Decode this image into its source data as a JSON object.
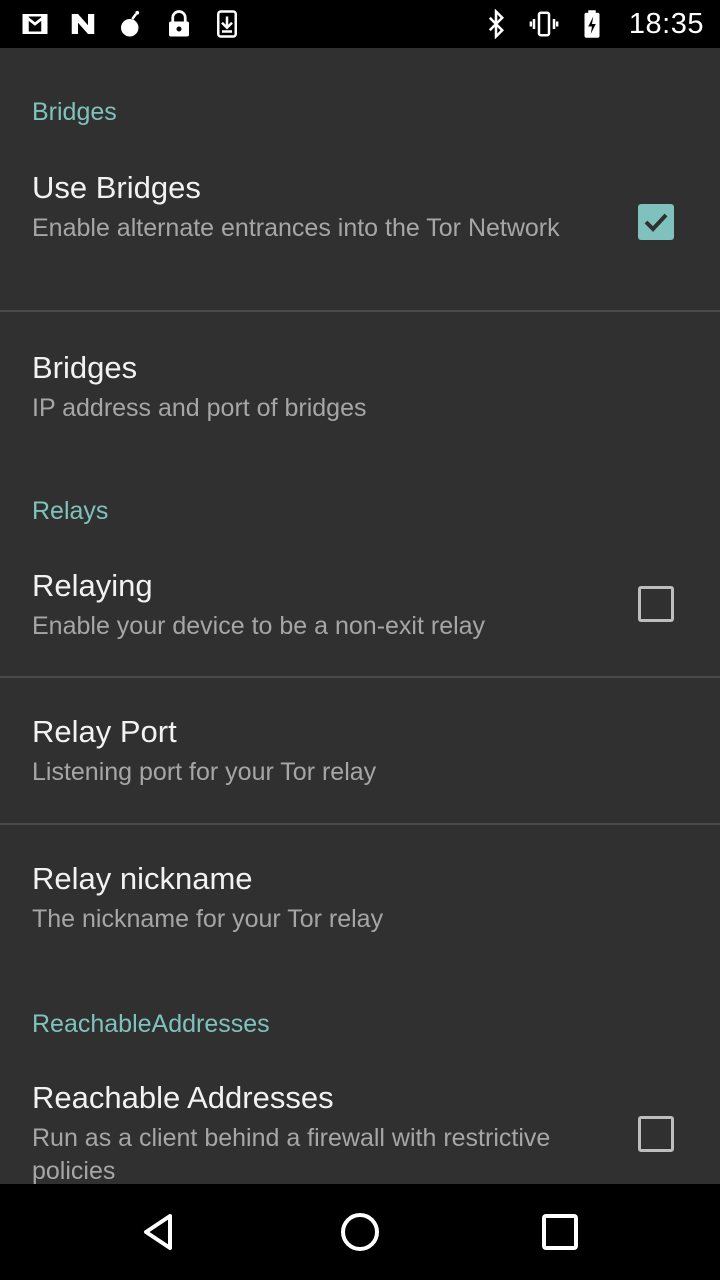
{
  "status_bar": {
    "left_icons": [
      "gmail-icon",
      "notification-n-icon",
      "bomb-icon",
      "lock-icon",
      "download-icon"
    ],
    "right_icons": [
      "bluetooth-icon",
      "vibrate-icon",
      "battery-charging-icon"
    ],
    "time": "18:35"
  },
  "sections": {
    "bridges": {
      "header": "Bridges",
      "use_bridges": {
        "title": "Use Bridges",
        "summary": "Enable alternate entrances into the Tor Network",
        "checked": true
      },
      "bridges": {
        "title": "Bridges",
        "summary": "IP address and port of bridges"
      }
    },
    "relays": {
      "header": "Relays",
      "relaying": {
        "title": "Relaying",
        "summary": "Enable your device to be a non-exit relay",
        "checked": false
      },
      "relay_port": {
        "title": "Relay Port",
        "summary": "Listening port for your Tor relay"
      },
      "relay_nickname": {
        "title": "Relay nickname",
        "summary": "The nickname for your Tor relay"
      }
    },
    "reachable": {
      "header": "ReachableAddresses",
      "reachable_addresses": {
        "title": "Reachable Addresses",
        "summary": "Run as a client behind a firewall with restrictive policies",
        "checked": false
      }
    }
  },
  "nav_bar": {
    "buttons": [
      "back-icon",
      "home-icon",
      "recents-icon"
    ]
  },
  "colors": {
    "accent": "#7fc2bd",
    "background": "#303030",
    "title": "#f2f2f2",
    "summary": "#a6a6a6"
  }
}
